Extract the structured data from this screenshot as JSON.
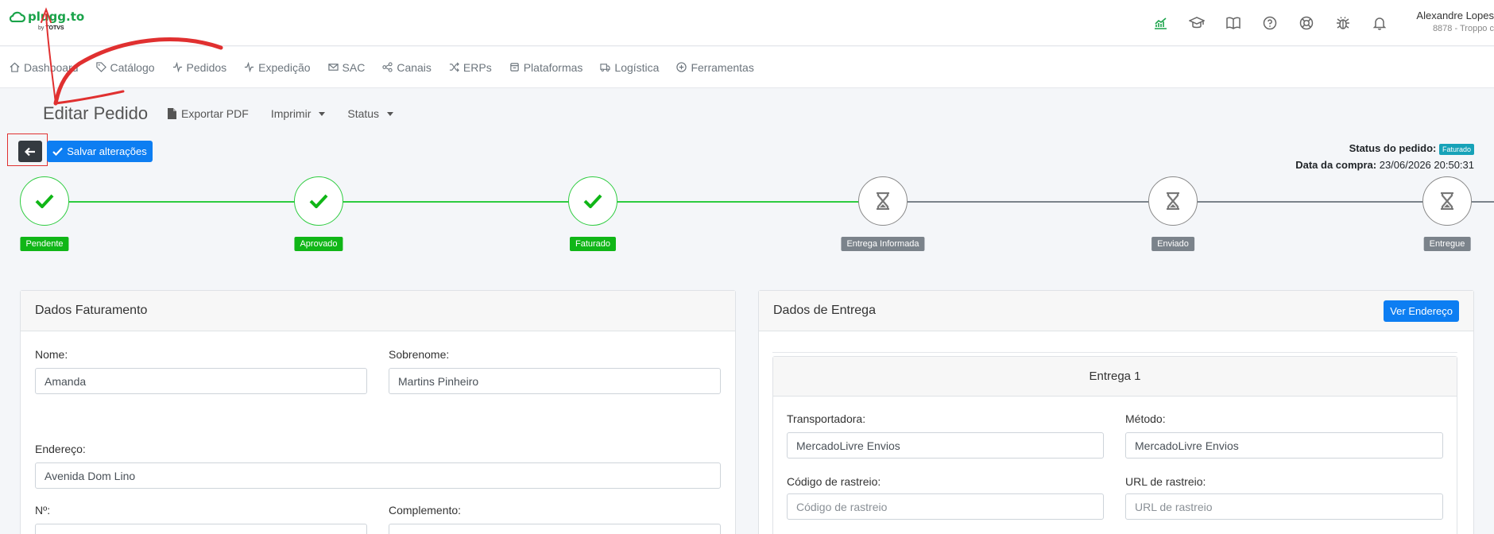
{
  "header": {
    "logo": "plugg.to",
    "logo_sub": "by",
    "logo_brand": "TOTVS",
    "user_name": "Alexandre Lopes",
    "user_sub": "8878 - Troppo c",
    "icons": [
      "chart-icon",
      "graduation-cap-icon",
      "book-icon",
      "help-icon",
      "support-icon",
      "bug-icon",
      "bell-icon"
    ]
  },
  "nav": {
    "items": [
      {
        "label": "Dashboard",
        "icon": "home-icon"
      },
      {
        "label": "Catálogo",
        "icon": "tag-icon"
      },
      {
        "label": "Pedidos",
        "icon": "activity-icon"
      },
      {
        "label": "Expedição",
        "icon": "activity-icon"
      },
      {
        "label": "SAC",
        "icon": "mail-icon"
      },
      {
        "label": "Canais",
        "icon": "share-icon"
      },
      {
        "label": "ERPs",
        "icon": "shuffle-icon"
      },
      {
        "label": "Plataformas",
        "icon": "box-icon"
      },
      {
        "label": "Logística",
        "icon": "truck-icon"
      },
      {
        "label": "Ferramentas",
        "icon": "plus-circle-icon"
      }
    ]
  },
  "page": {
    "title": "Editar Pedido",
    "export_pdf": "Exportar PDF",
    "print": "Imprimir",
    "status": "Status",
    "save_label": "Salvar alterações",
    "order_status_label": "Status do pedido:",
    "order_status_value": "Faturado",
    "purchase_date_label": "Data da compra:",
    "purchase_date_value": "23/06/2026 20:50:31"
  },
  "steps": [
    {
      "label": "Pendente",
      "state": "done"
    },
    {
      "label": "Aprovado",
      "state": "done"
    },
    {
      "label": "Faturado",
      "state": "done"
    },
    {
      "label": "Entrega Informada",
      "state": "pending"
    },
    {
      "label": "Enviado",
      "state": "pending"
    },
    {
      "label": "Entregue",
      "state": "pending"
    }
  ],
  "billing": {
    "title": "Dados Faturamento",
    "first_name_label": "Nome:",
    "first_name_value": "Amanda",
    "last_name_label": "Sobrenome:",
    "last_name_value": "Martins Pinheiro",
    "address_label": "Endereço:",
    "address_value": "Avenida Dom Lino",
    "number_label": "Nº:",
    "complement_label": "Complemento:"
  },
  "delivery": {
    "title": "Dados de Entrega",
    "view_address": "Ver Endereço",
    "shipment_title": "Entrega 1",
    "carrier_label": "Transportadora:",
    "carrier_value": "MercadoLivre Envios",
    "method_label": "Método:",
    "method_value": "MercadoLivre Envios",
    "tracking_code_label": "Código de rastreio:",
    "tracking_code_placeholder": "Código de rastreio",
    "tracking_url_label": "URL de rastreio:",
    "tracking_url_placeholder": "URL de rastreio"
  },
  "colors": {
    "brand_green": "#1aa34a",
    "primary_blue": "#0d7ef2",
    "done_green": "#10b617",
    "pending_gray": "#7b838b",
    "info_badge": "#17a2b8",
    "annotation_red": "#e03030"
  }
}
